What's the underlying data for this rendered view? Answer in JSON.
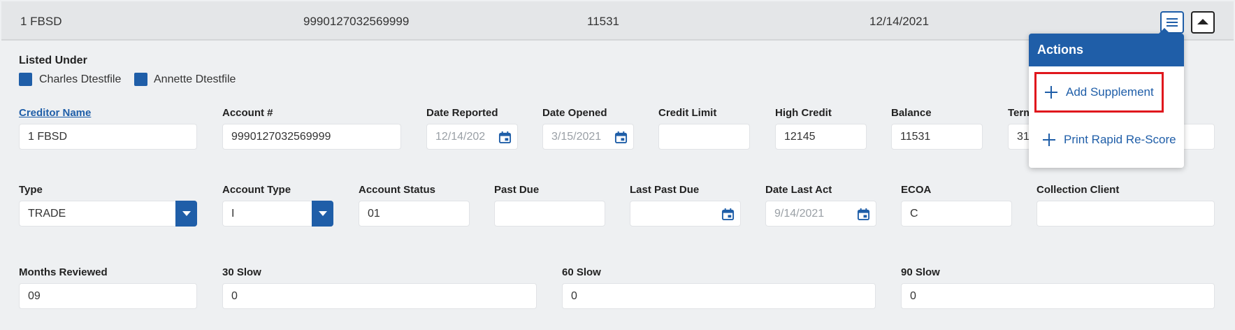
{
  "summary": {
    "creditor": "1 FBSD",
    "account": "9990127032569999",
    "balance": "11531",
    "date": "12/14/2021"
  },
  "listed_under": {
    "title": "Listed Under",
    "names": [
      "Charles Dtestfile",
      "Annette Dtestfile"
    ]
  },
  "row1": {
    "creditor_name_label": "Creditor Name",
    "creditor_name_value": "1 FBSD",
    "account_label": "Account #",
    "account_value": "9990127032569999",
    "date_reported_label": "Date Reported",
    "date_reported_value": "12/14/202",
    "date_opened_label": "Date Opened",
    "date_opened_value": "3/15/2021",
    "credit_limit_label": "Credit Limit",
    "credit_limit_value": "",
    "high_credit_label": "High Credit",
    "high_credit_value": "12145",
    "balance_label": "Balance",
    "balance_value": "11531",
    "terms_label": "Term",
    "terms_value": "31"
  },
  "row2": {
    "type_label": "Type",
    "type_value": "TRADE",
    "account_type_label": "Account Type",
    "account_type_value": "I",
    "account_status_label": "Account Status",
    "account_status_value": "01",
    "past_due_label": "Past Due",
    "past_due_value": "",
    "last_past_due_label": "Last Past Due",
    "last_past_due_value": "",
    "date_last_act_label": "Date Last Act",
    "date_last_act_value": "9/14/2021",
    "ecoa_label": "ECOA",
    "ecoa_value": "C",
    "collection_client_label": "Collection Client",
    "collection_client_value": ""
  },
  "row3": {
    "months_reviewed_label": "Months Reviewed",
    "months_reviewed_value": "09",
    "slow30_label": "30 Slow",
    "slow30_value": "0",
    "slow60_label": "60 Slow",
    "slow60_value": "0",
    "slow90_label": "90 Slow",
    "slow90_value": "0"
  },
  "actions_menu": {
    "title": "Actions",
    "items": [
      "Add Supplement",
      "Print Rapid Re-Score"
    ]
  },
  "colors": {
    "accent": "#1f5ea8",
    "highlight": "#e0171d"
  },
  "icons": [
    "menu-icon",
    "collapse-icon",
    "calendar-icon",
    "chevron-down-icon",
    "plus-icon"
  ]
}
